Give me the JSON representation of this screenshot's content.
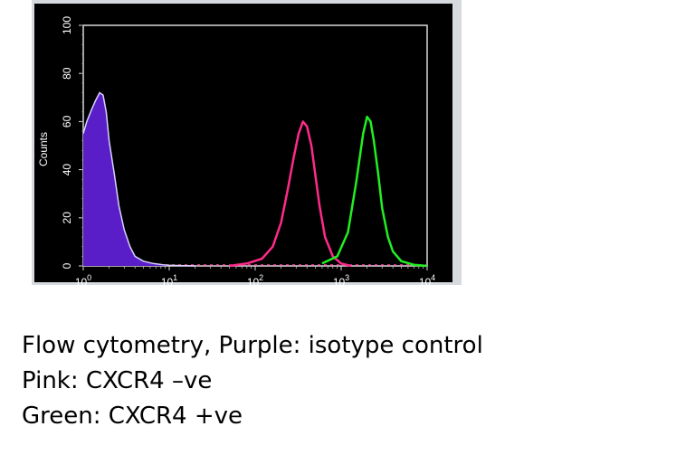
{
  "chart_data": {
    "type": "area",
    "xscale": "log",
    "xlim": [
      1,
      10000
    ],
    "ylim": [
      0,
      100
    ],
    "xlabel": "",
    "ylabel": "Counts",
    "x_ticks": [
      {
        "value": 1,
        "base": "10",
        "exp": "0"
      },
      {
        "value": 10,
        "base": "10",
        "exp": "1"
      },
      {
        "value": 100,
        "base": "10",
        "exp": "2"
      },
      {
        "value": 1000,
        "base": "10",
        "exp": "3"
      },
      {
        "value": 10000,
        "base": "10",
        "exp": "4"
      }
    ],
    "y_ticks": [
      "0",
      "20",
      "40",
      "60",
      "80",
      "100"
    ],
    "grid": false,
    "series": [
      {
        "id": "purple",
        "color": "#5a1ec8",
        "outline": "#d8d2ff",
        "filled": true,
        "x": [
          1,
          1.1,
          1.25,
          1.4,
          1.55,
          1.7,
          1.85,
          2.0,
          2.3,
          2.6,
          3.0,
          3.5,
          4.0,
          5.0,
          6.5,
          8.5,
          10,
          15,
          20
        ],
        "y": [
          55,
          60,
          65,
          69,
          72,
          71,
          64,
          52,
          38,
          25,
          15,
          8,
          4,
          2,
          1,
          0.5,
          0.3,
          0.1,
          0
        ]
      },
      {
        "id": "pink",
        "color": "#ff2a8a",
        "filled": false,
        "x": [
          50,
          80,
          120,
          160,
          200,
          240,
          280,
          320,
          360,
          400,
          450,
          500,
          560,
          650,
          800,
          1000,
          1300
        ],
        "y": [
          0,
          1,
          3,
          8,
          18,
          32,
          45,
          55,
          60,
          58,
          50,
          38,
          25,
          12,
          4,
          1,
          0
        ]
      },
      {
        "id": "green",
        "color": "#22ee22",
        "filled": false,
        "x": [
          600,
          900,
          1200,
          1500,
          1800,
          2000,
          2200,
          2400,
          2700,
          3000,
          3500,
          4000,
          5000,
          7000,
          10000
        ],
        "y": [
          1,
          4,
          14,
          35,
          55,
          62,
          60,
          52,
          38,
          24,
          12,
          6,
          2,
          0.5,
          0
        ]
      }
    ]
  },
  "caption": {
    "line1": "Flow cytometry, Purple: isotype control",
    "line2": "Pink: CXCR4 –ve",
    "line3": "Green: CXCR4 +ve"
  }
}
